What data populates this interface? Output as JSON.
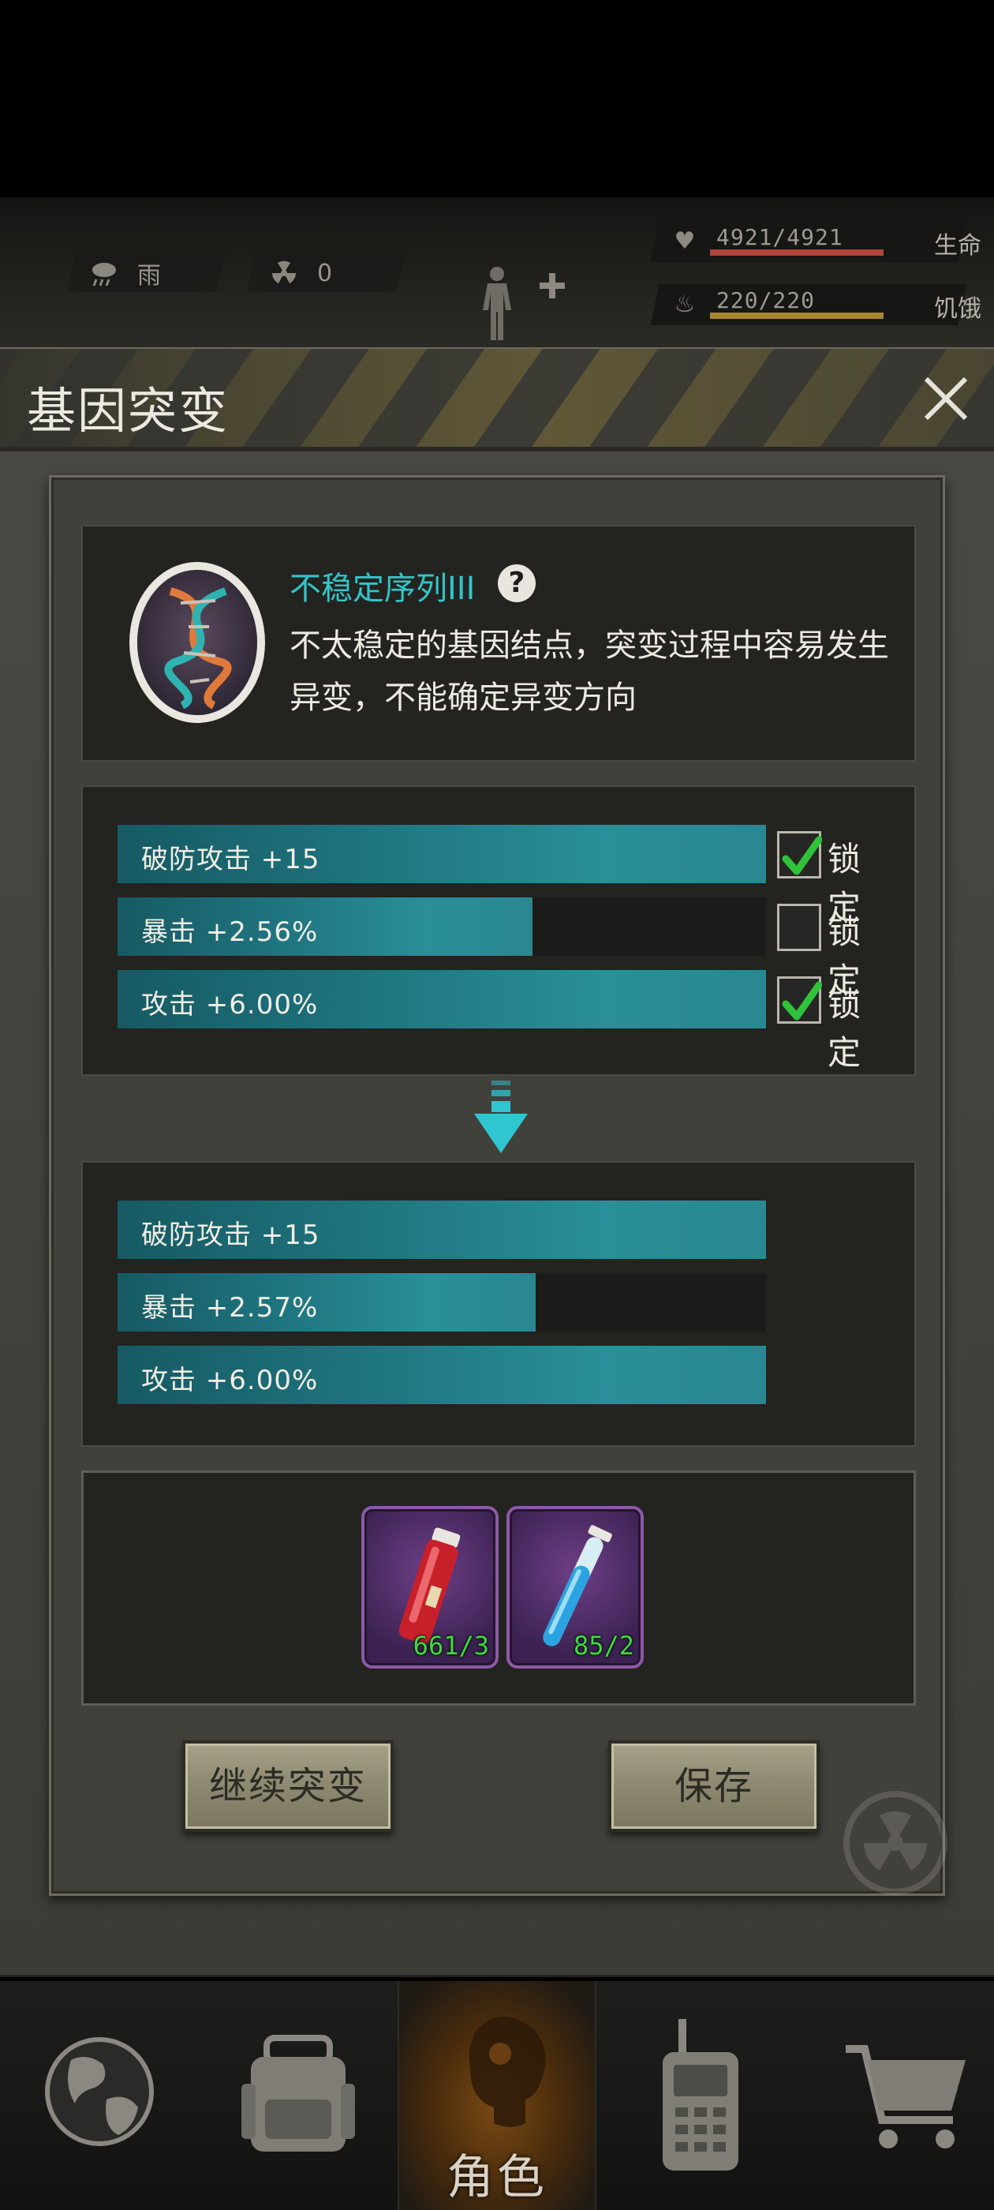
{
  "status": {
    "weather": "雨",
    "radiation": "0",
    "health_value": "4921/4921",
    "health_label": "生命",
    "hunger_value": "220/220",
    "hunger_label": "饥饿",
    "health_fraction": 1.0,
    "hunger_fraction": 1.0
  },
  "modal": {
    "title": "基因突变",
    "gene": {
      "name": "不稳定序列III",
      "description": "不太稳定的基因结点，突变过程中容易发生异变，不能确定异变方向"
    },
    "current_attributes": [
      {
        "text": "破防攻击 +15",
        "fill": 1.0,
        "locked": true,
        "lock_label": "锁定"
      },
      {
        "text": "暴击 +2.56%",
        "fill": 0.64,
        "locked": false,
        "lock_label": "锁定"
      },
      {
        "text": "攻击 +6.00%",
        "fill": 1.0,
        "locked": true,
        "lock_label": "锁定"
      }
    ],
    "new_attributes": [
      {
        "text": "破防攻击 +15",
        "fill": 1.0
      },
      {
        "text": "暴击 +2.57%",
        "fill": 0.645
      },
      {
        "text": "攻击 +6.00%",
        "fill": 1.0
      }
    ],
    "items": [
      {
        "icon": "red-potion-icon",
        "count": "661/3"
      },
      {
        "icon": "blue-test-tube-icon",
        "count": "85/2"
      }
    ],
    "continue_button": "继续突变",
    "save_button": "保存"
  },
  "nav": {
    "items": [
      {
        "icon": "globe-icon"
      },
      {
        "icon": "backpack-icon"
      },
      {
        "icon": "character-icon",
        "label": "角色",
        "active": true
      },
      {
        "icon": "walkie-talkie-icon"
      },
      {
        "icon": "shopping-cart-icon"
      }
    ]
  },
  "colors": {
    "accent_teal": "#2a8f98",
    "gene_name": "#31c6c9",
    "item_count": "#3ddc3d",
    "health_bar": "#b0463b",
    "hunger_bar": "#a8862e"
  }
}
